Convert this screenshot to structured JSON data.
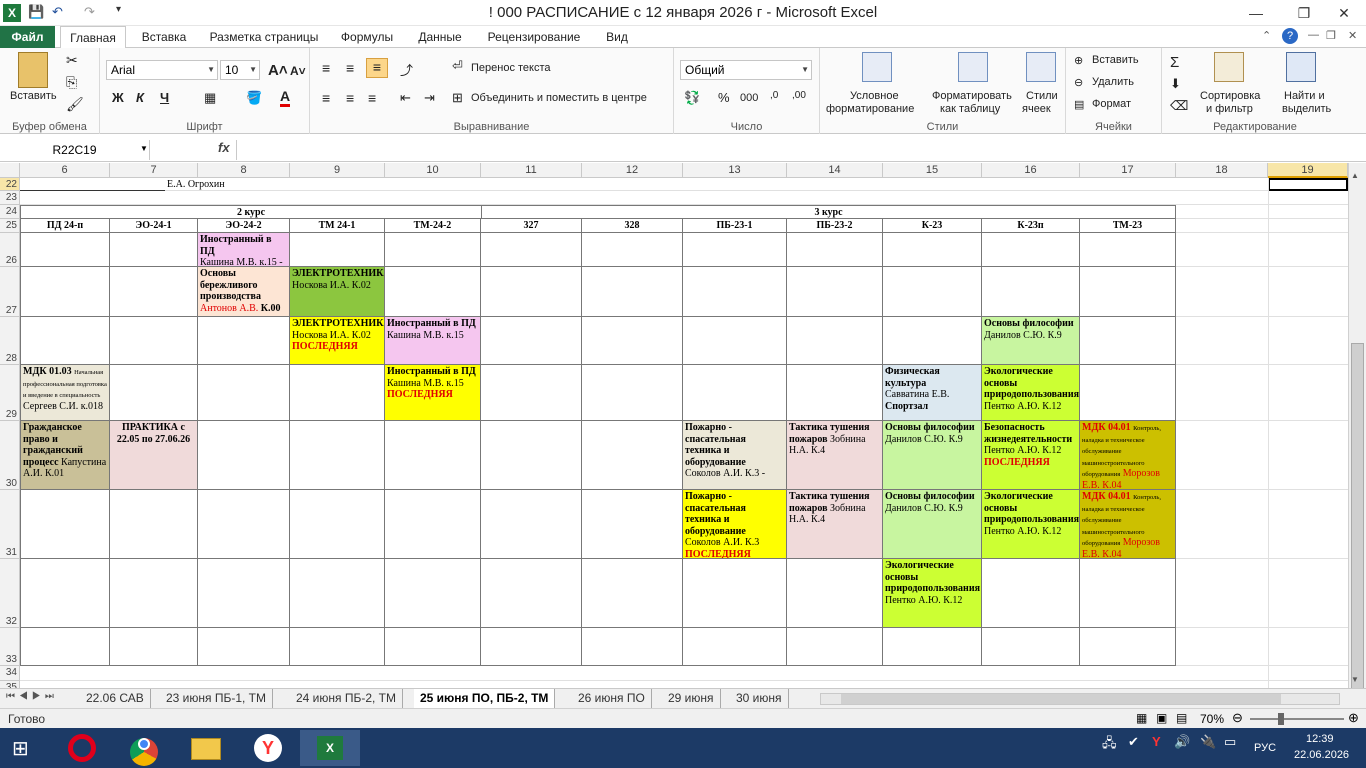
{
  "window": {
    "title": "! 000 РАСПИСАНИЕ с 12 января 2026 г  -  Microsoft Excel",
    "app_icon": "X"
  },
  "ribbon_tabs": [
    "Файл",
    "Главная",
    "Вставка",
    "Разметка страницы",
    "Формулы",
    "Данные",
    "Рецензирование",
    "Вид"
  ],
  "ribbon": {
    "clipboard": {
      "paste": "Вставить",
      "label": "Буфер обмена"
    },
    "font": {
      "name": "Arial",
      "size": "10",
      "label": "Шрифт",
      "bold": "Ж",
      "italic": "К",
      "underline": "Ч"
    },
    "alignment": {
      "wrap": "Перенос текста",
      "merge": "Объединить и поместить в центре",
      "label": "Выравнивание"
    },
    "number": {
      "format": "Общий",
      "label": "Число"
    },
    "styles": {
      "conditional": "Условное",
      "conditional2": "форматирование",
      "table": "Форматировать",
      "table2": "как таблицу",
      "cell": "Стили",
      "cell2": "ячеек",
      "label": "Стили"
    },
    "cells": {
      "insert": "Вставить",
      "delete": "Удалить",
      "format": "Формат",
      "label": "Ячейки"
    },
    "editing": {
      "sort": "Сортировка",
      "sort2": "и фильтр",
      "find": "Найти и",
      "find2": "выделить",
      "label": "Редактирование"
    }
  },
  "formula_bar": {
    "namebox": "R22C19",
    "fx": "fx",
    "value": ""
  },
  "columns": [
    "6",
    "7",
    "8",
    "9",
    "10",
    "11",
    "12",
    "13",
    "14",
    "15",
    "16",
    "17",
    "18",
    "19"
  ],
  "rows": [
    "22",
    "23",
    "24",
    "25",
    "26",
    "27",
    "28",
    "29",
    "30",
    "31",
    "32",
    "33",
    "34",
    "35"
  ],
  "header_cells": {
    "r22": "Е.А. Огрохин",
    "course2": "2 курс",
    "course3": "3 курс",
    "groups": [
      "ПД 24-п",
      "ЭО-24-1",
      "ЭО-24-2",
      "ТМ 24-1",
      "ТМ-24-2",
      "327",
      "328",
      "ПБ-23-1",
      "ПБ-23-2",
      "К-23",
      "К-23п",
      "ТМ-23"
    ]
  },
  "lessons": {
    "r26_c8_b": "Иностранный в ПД",
    "r26_c8": "Кашина М.В. к.15  -",
    "r27_c8_b": "Основы бережливого производства",
    "r27_c8_r": "Антонов А.В.",
    "r27_c8": " К.00",
    "r27_c9_b": "ЭЛЕКТРОТЕХНИКА",
    "r27_c9": "Носкова И.А. К.02",
    "r28_c9_b": "ЭЛЕКТРОТЕХНИКА",
    "r28_c9": "Носкова И.А. К.02",
    "r28_c9_r": "ПОСЛЕДНЯЯ",
    "r28_c10_b": "Иностранный в ПД",
    "r28_c10": "Кашина М.В. к.15",
    "r28_c16_b": "Основы философии",
    "r28_c16": "Данилов С.Ю. К.9",
    "r29_c6_b": "МДК 01.03",
    "r29_c6_s": "Начальная профессиональная подготовка и введение в специальность",
    "r29_c6": "Сергеев С.И. к.018",
    "r29_c10_b": "Иностранный в ПД",
    "r29_c10": "Кашина М.В. к.15",
    "r29_c10_r": "ПОСЛЕДНЯЯ",
    "r29_c15_b": "Физическая культура",
    "r29_c15": "Савватина Е.В.",
    "r29_c15_b2": "Спортзал",
    "r29_c16_b": "Экологические основы природопользования",
    "r29_c16": "Пентко А.Ю. К.12",
    "r30_c6_b": "Гражданское право и гражданский процесс",
    "r30_c6": "Капустина А.И. К.01",
    "r30_c7_b": "ПРАКТИКА  с 22.05 по 27.06.26",
    "r30_c13_b": "Пожарно - спасательная техника и оборудование",
    "r30_c13": "Соколов А.И. К.3 -",
    "r30_c14_b": "Тактика тушения пожаров",
    "r30_c14": "Зобнина Н.А. К.4",
    "r30_c15_b": "Основы философии",
    "r30_c15": "Данилов С.Ю. К.9",
    "r30_c16_b": "Безопасность жизнедеятельности",
    "r30_c16": "Пентко А.Ю. К.12",
    "r30_c16_r": "ПОСЛЕДНЯЯ",
    "r30_c17_rb": "МДК 04.01",
    "r30_c17_s": "Контроль, наладка и техническое обслуживание машиностроительного оборудования",
    "r30_c17_r": "Морозов Е.В. К.04",
    "r31_c13_b": "Пожарно - спасательная техника и оборудование",
    "r31_c13": "Соколов А.И. К.3",
    "r31_c13_r": "ПОСЛЕДНЯЯ",
    "r31_c14_b": "Тактика тушения пожаров",
    "r31_c14": "Зобнина Н.А. К.4",
    "r31_c15_b": "Основы философии",
    "r31_c15": "Данилов С.Ю. К.9",
    "r31_c16_b": "Экологические основы природопользования",
    "r31_c16": "Пентко А.Ю. К.12",
    "r31_c17_rb": "МДК 04.01",
    "r31_c17_s": "Контроль, наладка и техническое обслуживание машиностроительного оборудования",
    "r31_c17_r": "Морозов Е.В. К.04",
    "r32_c15_b": "Экологические основы природопользования",
    "r32_c15": "Пентко А.Ю. К.12"
  },
  "sheet_tabs": [
    "22.06 САВ",
    "23 июня ПБ-1, ТМ",
    "24 июня ПБ-2, ТМ",
    "25 июня ПО, ПБ-2, ТМ",
    "26 июня ПО",
    "29 июня",
    "30 июня"
  ],
  "status": {
    "ready": "Готово",
    "zoom": "70%"
  },
  "taskbar": {
    "lang": "РУС",
    "time": "12:39",
    "date": "22.06.2026"
  },
  "colors": {
    "pink": "#f5c6ef",
    "peach": "#fde5d4",
    "green": "#8cc63f",
    "yellow": "#ffff00",
    "khaki": "#c9c098",
    "rosy": "#f0dada",
    "lightgreen": "#c8f5a0",
    "lime": "#ccff33",
    "paleblue": "#dce8f0",
    "olive": "#ccc000",
    "beige": "#ece8d8"
  }
}
